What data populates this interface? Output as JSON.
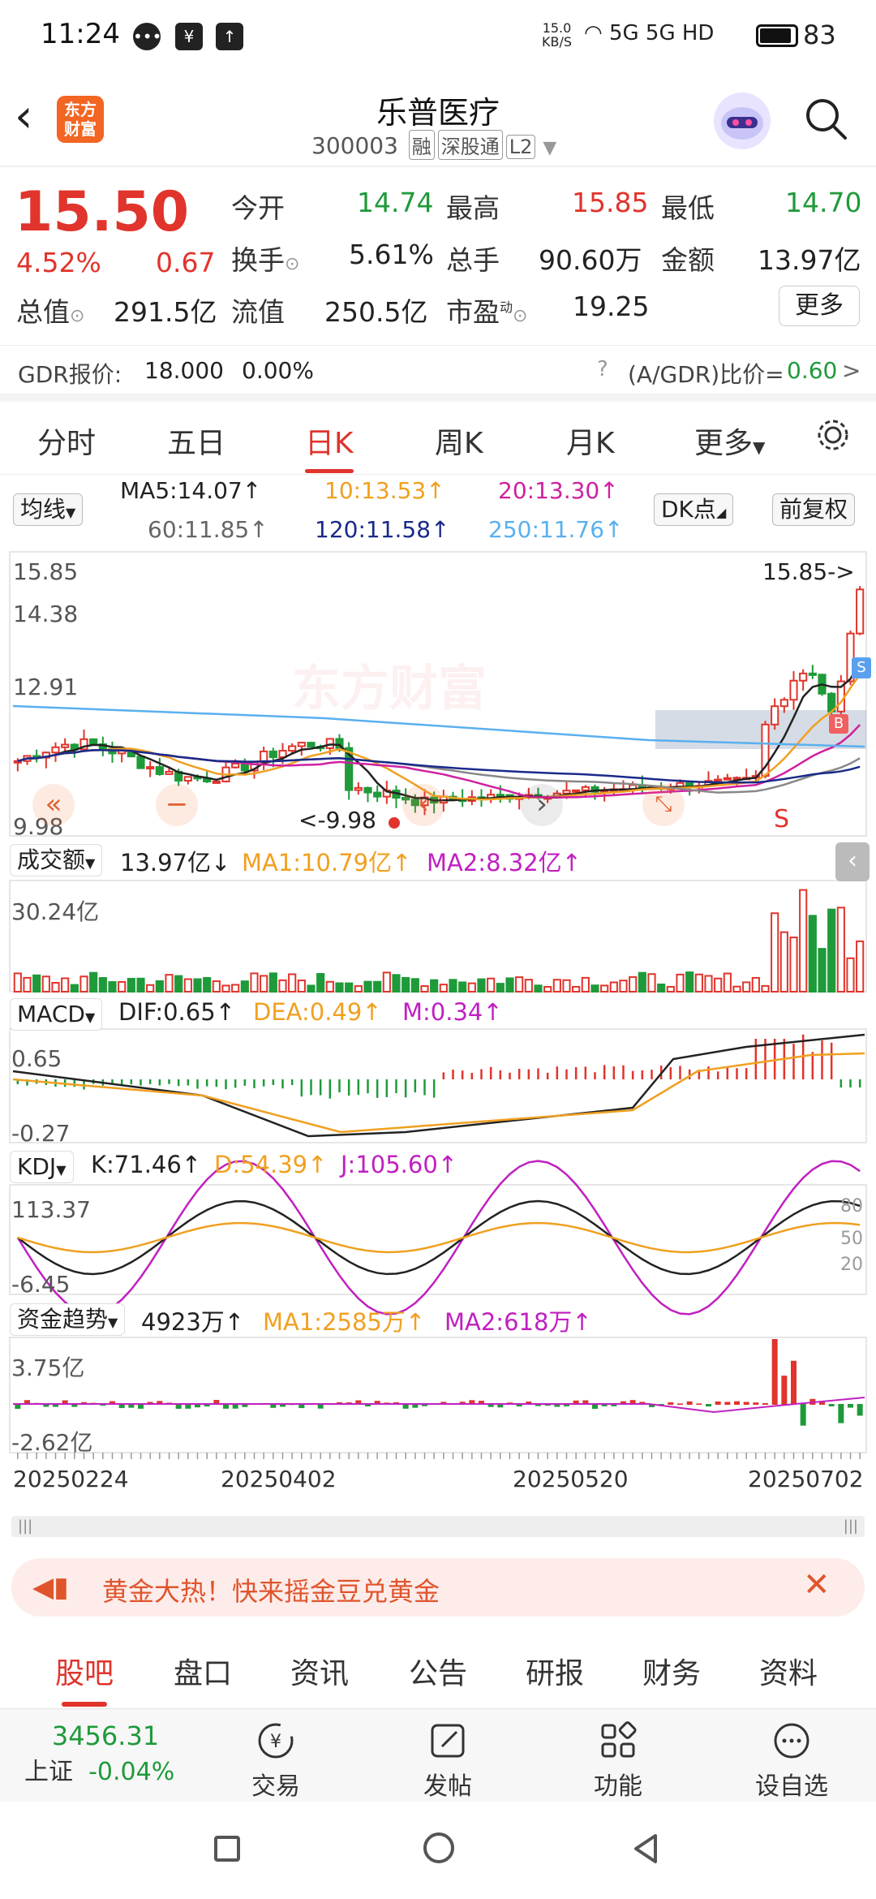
{
  "status_bar": {
    "time": "11:24",
    "net_speed_top": "15.0",
    "net_speed_bottom": "KB/S",
    "network": "5G 5G HD",
    "battery": "83"
  },
  "header": {
    "name": "乐普医疗",
    "code": "300003",
    "tags": [
      "融",
      "深股通",
      "L2"
    ],
    "logo_text": "东方财富"
  },
  "quote": {
    "price": "15.50",
    "change_pct": "4.52%",
    "change": "0.67",
    "open_label": "今开",
    "open": "14.74",
    "high_label": "最高",
    "high": "15.85",
    "low_label": "最低",
    "low": "14.70",
    "turnover_label": "换手",
    "turnover": "5.61%",
    "volume_label": "总手",
    "volume": "90.60万",
    "amount_label": "金额",
    "amount": "13.97亿",
    "mcap_label": "总值",
    "mcap": "291.5亿",
    "float_label": "流值",
    "float": "250.5亿",
    "pe_label": "市盈",
    "pe_sup": "动",
    "pe": "19.25",
    "more": "更多"
  },
  "gdr": {
    "label": "GDR报价:",
    "price": "18.000",
    "pct": "0.00%",
    "ratio_label": "(A/GDR)比价=",
    "ratio": "0.60",
    "arrow": ">"
  },
  "period_tabs": [
    "分时",
    "五日",
    "日K",
    "周K",
    "月K",
    "更多"
  ],
  "ma_row": {
    "selector": "均线",
    "ma5": "MA5:14.07↑",
    "ma10": "10:13.53↑",
    "ma20": "20:13.30↑",
    "ma60": "60:11.85↑",
    "ma120": "120:11.58↑",
    "ma250": "250:11.76↑",
    "dk": "DK点",
    "adjust": "前复权"
  },
  "kline": {
    "y_top": "15.85",
    "y_2": "14.38",
    "y_3": "12.91",
    "y_bottom": "9.98",
    "high_marker": "15.85->",
    "low_marker": "<-9.98",
    "watermark": "东方财富",
    "b_mark": "B",
    "s_mark": "S",
    "s_mark2": "S"
  },
  "volume": {
    "selector": "成交额",
    "value": "13.97亿↓",
    "ma1": "MA1:10.79亿↑",
    "ma2": "MA2:8.32亿↑",
    "y_top": "30.24亿"
  },
  "macd": {
    "selector": "MACD",
    "dif": "DIF:0.65↑",
    "dea": "DEA:0.49↑",
    "m": "M:0.34↑",
    "y_top": "0.65",
    "y_bottom": "-0.27"
  },
  "kdj": {
    "selector": "KDJ",
    "k": "K:71.46↑",
    "d": "D:54.39↑",
    "j": "J:105.60↑",
    "y_top": "113.37",
    "y_bottom": "-6.45",
    "r80": "80",
    "r50": "50",
    "r20": "20"
  },
  "fund": {
    "selector": "资金趋势",
    "value": "4923万↑",
    "ma1": "MA1:2585万↑",
    "ma2": "MA2:618万↑",
    "y_top": "3.75亿",
    "y_bottom": "-2.62亿"
  },
  "dates": [
    "20250224",
    "20250402",
    "20250520",
    "20250702"
  ],
  "banner": {
    "text": "黄金大热！快来摇金豆兑黄金"
  },
  "bottom_tabs": [
    "股吧",
    "盘口",
    "资讯",
    "公告",
    "研报",
    "财务",
    "资料"
  ],
  "bottom_nav": {
    "index_value": "3456.31",
    "index_name": "上证",
    "index_change": "-0.04%",
    "trade": "交易",
    "post": "发帖",
    "func": "功能",
    "watch": "设自选"
  },
  "colors": {
    "red": "#e0342c",
    "green": "#1f9a3a",
    "ma5": "#222222",
    "ma10": "#f0a020",
    "ma20": "#d020a0",
    "ma60": "#888888",
    "ma120": "#1a2a8a",
    "ma250": "#5ab0ee"
  }
}
